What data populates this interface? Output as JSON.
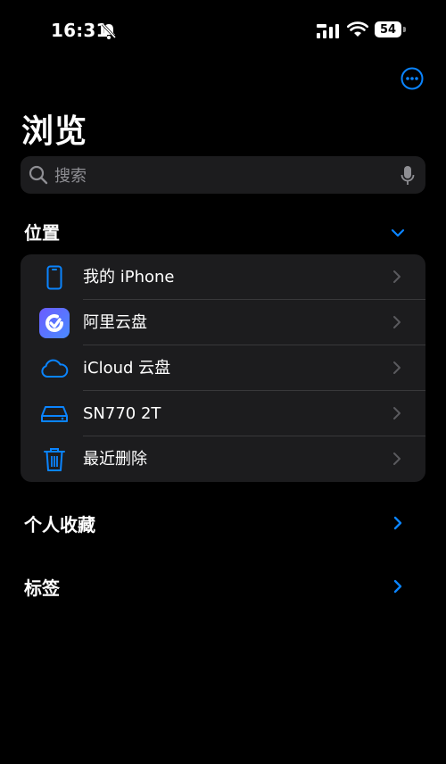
{
  "status_bar": {
    "time": "16:31",
    "battery": "54"
  },
  "page": {
    "title": "浏览"
  },
  "search": {
    "placeholder": "搜索"
  },
  "locations": {
    "header": "位置",
    "items": [
      {
        "label": "我的 iPhone",
        "icon": "iphone-icon"
      },
      {
        "label": "阿里云盘",
        "icon": "aliyun-drive-icon"
      },
      {
        "label": "iCloud 云盘",
        "icon": "icloud-icon"
      },
      {
        "label": "SN770 2T",
        "icon": "external-drive-icon"
      },
      {
        "label": "最近删除",
        "icon": "trash-icon"
      }
    ]
  },
  "favorites": {
    "header": "个人收藏"
  },
  "tags": {
    "header": "标签"
  },
  "colors": {
    "accent": "#0a84ff",
    "background": "#000000",
    "card": "#1c1c1e",
    "secondary_text": "#8e8e93"
  }
}
